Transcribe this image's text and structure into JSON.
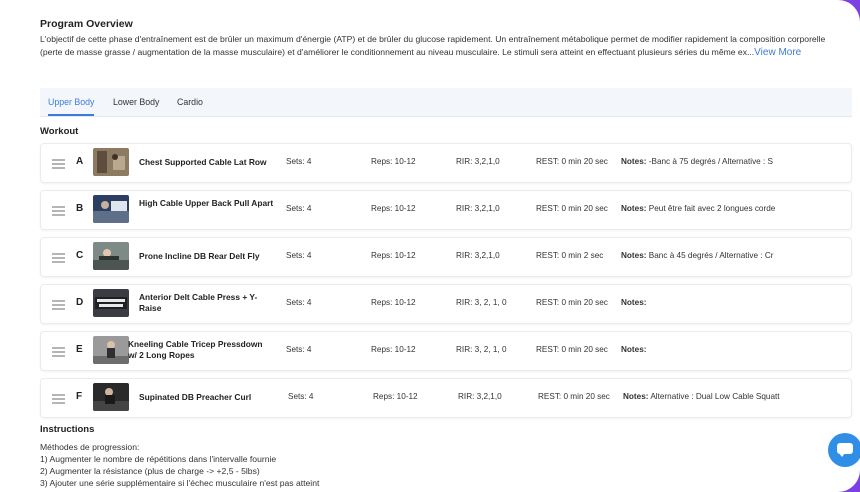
{
  "overview": {
    "title": "Program Overview",
    "text": "L'objectif de cette phase d'entraînement est de brûler un maximum d'énergie (ATP) et de brûler du glucose rapidement. Un entraînement métabolique permet de modifier rapidement la composition corporelle (perte de masse grasse / augmentation de la masse musculaire) et d'améliorer le conditionnement au niveau musculaire. Le stimuli sera atteint en effectuant plusieurs séries du même ex...",
    "view_more": "View More"
  },
  "tabs": [
    {
      "label": "Upper Body",
      "active": true
    },
    {
      "label": "Lower Body",
      "active": false
    },
    {
      "label": "Cardio",
      "active": false
    }
  ],
  "workout_label": "Workout",
  "exercises": [
    {
      "letter": "A",
      "name": "Chest Supported Cable Lat Row",
      "sets": "Sets: 4",
      "reps": "Reps: 10-12",
      "rir": "RIR: 3,2,1,0",
      "rest": "REST: 0 min 20 sec",
      "notes_label": "Notes:",
      "notes": "-Banc à 75 degrés / Alternative : S"
    },
    {
      "letter": "B",
      "name": "High Cable Upper Back Pull Apart",
      "sets": "Sets: 4",
      "reps": "Reps: 10-12",
      "rir": "RIR: 3,2,1,0",
      "rest": "REST: 0 min 20 sec",
      "notes_label": "Notes:",
      "notes": "Peut être fait avec 2 longues corde"
    },
    {
      "letter": "C",
      "name": "Prone Incline DB Rear Delt Fly",
      "sets": "Sets: 4",
      "reps": "Reps: 10-12",
      "rir": "RIR: 3,2,1,0",
      "rest": "REST: 0 min 2 sec",
      "notes_label": "Notes:",
      "notes": "Banc à 45 degrés / Alternative : Cr"
    },
    {
      "letter": "D",
      "name": "Anterior Delt Cable Press + Y-Raise",
      "sets": "Sets: 4",
      "reps": "Reps: 10-12",
      "rir": "RIR: 3, 2, 1, 0",
      "rest": "REST: 0 min 20 sec",
      "notes_label": "Notes:",
      "notes": ""
    },
    {
      "letter": "E",
      "name": "Kneeling Cable Tricep Pressdown w/ 2 Long Ropes",
      "sets": "Sets: 4",
      "reps": "Reps: 10-12",
      "rir": "RIR: 3, 2, 1, 0",
      "rest": "REST: 0 min 20 sec",
      "notes_label": "Notes:",
      "notes": ""
    },
    {
      "letter": "F",
      "name": "Supinated DB Preacher Curl",
      "sets": "Sets: 4",
      "reps": "Reps: 10-12",
      "rir": "RIR: 3,2,1,0",
      "rest": "REST: 0 min 20 sec",
      "notes_label": "Notes:",
      "notes": "Alternative : Dual Low Cable Squatt"
    }
  ],
  "instructions": {
    "title": "Instructions",
    "lines": [
      "Méthodes de progression:",
      "1) Augmenter le nombre de répétitions dans l'intervalle fournie",
      "2) Augmenter la résistance (plus de charge -> +2,5 - 5lbs)",
      "3) Ajouter une série supplémentaire si l'échec musculaire n'est pas atteint"
    ]
  },
  "colors": {
    "accent": "#3b7bdc",
    "border": "#7b3fe4",
    "chat": "#2f8fe6"
  },
  "icons": {
    "drag": "drag-handle-icon",
    "chat": "chat-icon"
  }
}
